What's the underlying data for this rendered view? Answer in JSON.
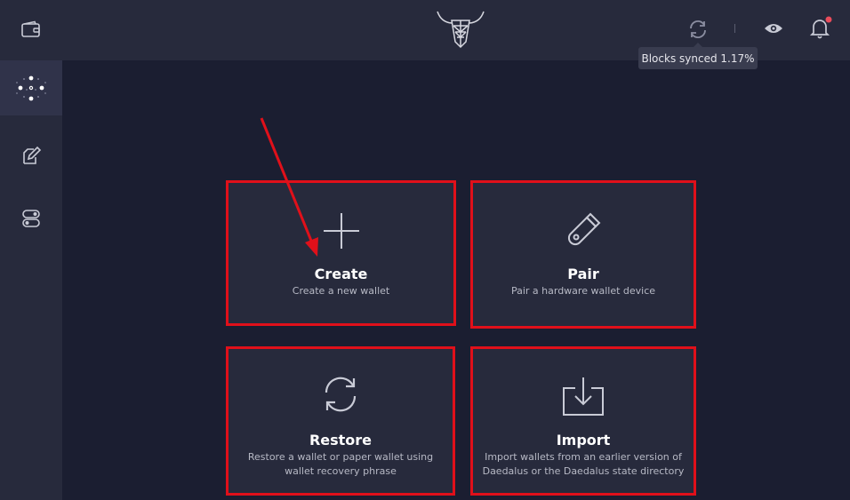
{
  "topbar": {
    "sync_tooltip": "Blocks synced 1.17%"
  },
  "sidebar": {
    "items": [
      {
        "icon": "wallet-icon"
      },
      {
        "icon": "network-icon",
        "active": true
      },
      {
        "icon": "edit-document-icon"
      },
      {
        "icon": "settings-toggle-icon"
      }
    ]
  },
  "cards": {
    "create": {
      "title": "Create",
      "desc": "Create a new wallet",
      "icon": "plus-icon"
    },
    "pair": {
      "title": "Pair",
      "desc": "Pair a hardware wallet device",
      "icon": "usb-device-icon"
    },
    "restore": {
      "title": "Restore",
      "desc_line1": "Restore a wallet or paper wallet using",
      "desc_line2": "wallet recovery phrase",
      "icon": "restore-icon"
    },
    "import": {
      "title": "Import",
      "desc_line1": "Import wallets from an earlier version of",
      "desc_line2": "Daedalus or the Daedalus state directory",
      "icon": "import-icon"
    }
  },
  "colors": {
    "background": "#1b1e31",
    "panel": "#272a3c",
    "highlight": "#e0101a",
    "notification_dot": "#ea4c5b"
  }
}
